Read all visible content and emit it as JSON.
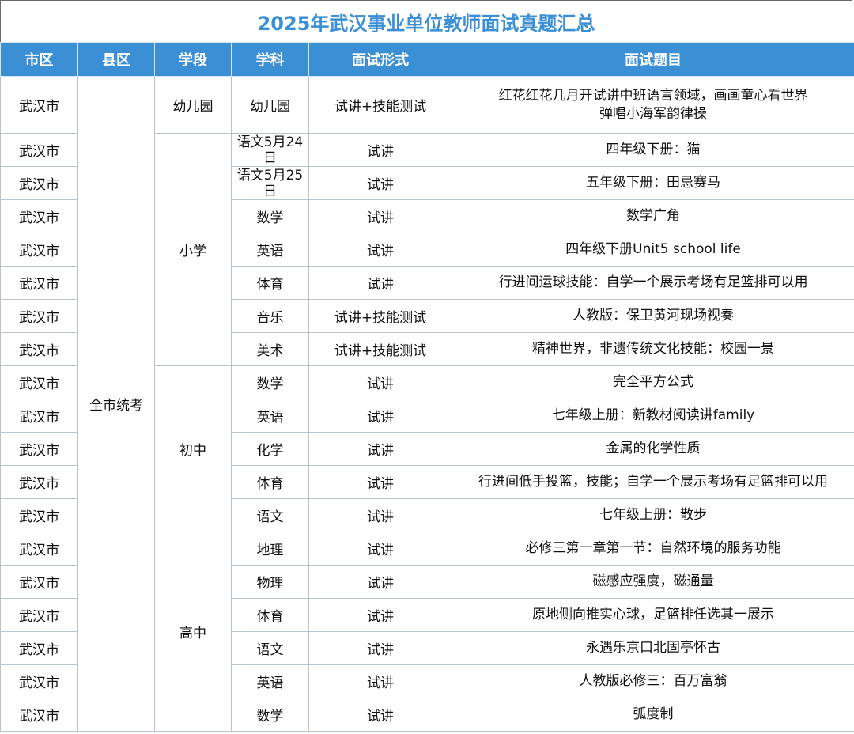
{
  "title": "2025年武汉事业单位教师面试真题汇总",
  "headers": {
    "city": "市区",
    "county": "县区",
    "stage": "学段",
    "subject": "学科",
    "format": "面试形式",
    "topic": "面试题目"
  },
  "county_all": "全市统考",
  "stages": {
    "kindergarten": "幼儿园",
    "primary": "小学",
    "junior": "初中",
    "senior": "高中"
  },
  "rows": [
    {
      "city": "武汉市",
      "subject": "幼儿园",
      "format": "试讲+技能测试",
      "topic": "红花红花几月开试讲中班语言领域，画画童心看世界\n弹唱小海军韵律操"
    },
    {
      "city": "武汉市",
      "subject": "语文5月24日",
      "format": "试讲",
      "topic": "四年级下册：猫"
    },
    {
      "city": "武汉市",
      "subject": "语文5月25日",
      "format": "试讲",
      "topic": "五年级下册：田忌赛马"
    },
    {
      "city": "武汉市",
      "subject": "数学",
      "format": "试讲",
      "topic": "数学广角"
    },
    {
      "city": "武汉市",
      "subject": "英语",
      "format": "试讲",
      "topic": "四年级下册Unit5 school life"
    },
    {
      "city": "武汉市",
      "subject": "体育",
      "format": "试讲",
      "topic": "行进间运球技能：自学一个展示考场有足篮排可以用"
    },
    {
      "city": "武汉市",
      "subject": "音乐",
      "format": "试讲+技能测试",
      "topic": "人教版：保卫黄河现场视奏"
    },
    {
      "city": "武汉市",
      "subject": "美术",
      "format": "试讲+技能测试",
      "topic": "精神世界，非遗传统文化技能：校园一景"
    },
    {
      "city": "武汉市",
      "subject": "数学",
      "format": "试讲",
      "topic": "完全平方公式"
    },
    {
      "city": "武汉市",
      "subject": "英语",
      "format": "试讲",
      "topic": "七年级上册：新教材阅读讲family"
    },
    {
      "city": "武汉市",
      "subject": "化学",
      "format": "试讲",
      "topic": "金属的化学性质"
    },
    {
      "city": "武汉市",
      "subject": "体育",
      "format": "试讲",
      "topic": "行进间低手投篮，技能；自学一个展示考场有足篮排可以用"
    },
    {
      "city": "武汉市",
      "subject": "语文",
      "format": "试讲",
      "topic": "七年级上册：散步"
    },
    {
      "city": "武汉市",
      "subject": "地理",
      "format": "试讲",
      "topic": "必修三第一章第一节：自然环境的服务功能"
    },
    {
      "city": "武汉市",
      "subject": "物理",
      "format": "试讲",
      "topic": "磁感应强度，磁通量"
    },
    {
      "city": "武汉市",
      "subject": "体育",
      "format": "试讲",
      "topic": "原地侧向推实心球，足篮排任选其一展示"
    },
    {
      "city": "武汉市",
      "subject": "语文",
      "format": "试讲",
      "topic": "永遇乐京口北固亭怀古"
    },
    {
      "city": "武汉市",
      "subject": "英语",
      "format": "试讲",
      "topic": "人教版必修三：百万富翁"
    },
    {
      "city": "武汉市",
      "subject": "数学",
      "format": "试讲",
      "topic": "弧度制"
    }
  ]
}
